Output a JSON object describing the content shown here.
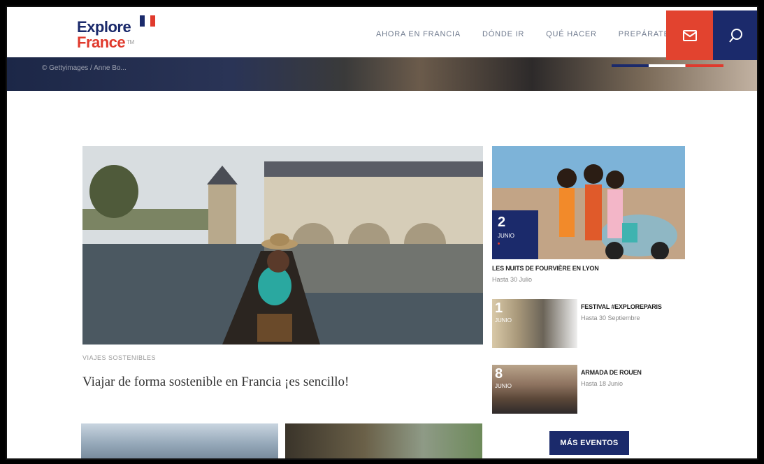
{
  "header": {
    "logo_line1": "Explore",
    "logo_line2": "France",
    "logo_tm": "TM",
    "nav": [
      "AHORA EN FRANCIA",
      "DÓNDE IR",
      "QUÉ HACER",
      "PREPÁRATE"
    ],
    "mail_icon": "mail-icon",
    "search_icon": "search-icon"
  },
  "hero": {
    "credit": "© Gettyimages / Anne Bo..."
  },
  "feature": {
    "category": "VIAJES SOSTENIBLES",
    "title": "Viajar de forma sostenible en Francia ¡es sencillo!"
  },
  "events": [
    {
      "day": "2",
      "month": "JUNIO",
      "title": "LES NUITS DE FOURVIÈRE EN LYON",
      "sub": "Hasta 30 Julio"
    },
    {
      "day": "1",
      "month": "JUNIO",
      "title": "FESTIVAL #EXPLOREPARIS",
      "sub": "Hasta 30 Septiembre"
    },
    {
      "day": "8",
      "month": "JUNIO",
      "title": "ARMADA DE ROUEN",
      "sub": "Hasta 18 Junio"
    }
  ],
  "more_events": "MÁS EVENTOS",
  "colors": {
    "navy": "#1b2a6b",
    "red": "#e2432f"
  }
}
